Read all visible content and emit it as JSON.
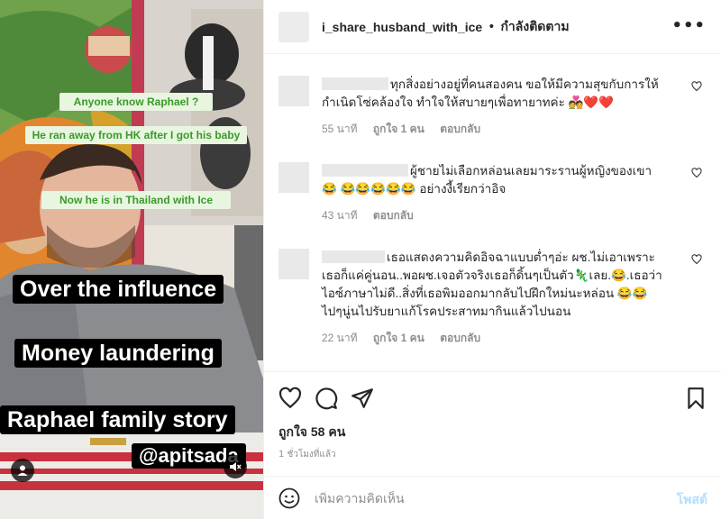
{
  "media": {
    "captions_small": [
      "Anyone know Raphael ?",
      "He ran away from HK after I got his baby",
      "Now he is in Thailand with Ice"
    ],
    "captions_big": [
      "Over the influence",
      "Money laundering",
      "Raphael family story"
    ],
    "mention": "@apitsada",
    "icons": {
      "profile": "person-icon",
      "sound": "muted-speaker-icon"
    }
  },
  "post": {
    "username": "i_share_husband_with_ice",
    "separator": "•",
    "follow_status": "กำลังติดตาม",
    "more_label": "•••"
  },
  "comments": [
    {
      "text": "ทุกสิ่งอย่างอยู่ที่คนสองคน ขอให้มีความสุขกับการให้กำเนิดโซ่คล้องใจ ทำใจให้สบายๆเพื่อทายาทค่ะ 💑❤️❤️",
      "time": "55 นาที",
      "likes": "ถูกใจ 1 คน",
      "reply": "ตอบกลับ"
    },
    {
      "text": "ผู้ชายไม่เลือกหล่อนเลยมาระรานผู้หญิงของเขา 😂 😂😂😂😂😂 อย่างงี้เรียกว่าอิจ",
      "time": "43 นาที",
      "likes": "",
      "reply": "ตอบกลับ"
    },
    {
      "text": "เธอแสดงความคิดอิจฉาแบบต่ำๆอ่ะ ผช.ไม่เอาเพราะเธอก็แค่คู่นอน..พอผช.เจอตัวจริงเธอก็ดิ้นๆเป็นตัว🦎เลย.😂.เธอว่าไอซ์ภาษาไม่ดี..สิ่งที่เธอพิมออกมากลับไปฝึกใหม่นะหล่อน 😂😂 ไปๆนู่นไปรับยาแก้โรคประสาทมากินแล้วไปนอน",
      "time": "22 นาที",
      "likes": "ถูกใจ 1 คน",
      "reply": "ตอบกลับ"
    }
  ],
  "actions": {
    "likes_count": "ถูกใจ 58 คน",
    "timestamp": "1 ชั่วโมงที่แล้ว"
  },
  "composer": {
    "placeholder": "เพิ่มความคิดเห็น",
    "post_label": "โพสต์"
  },
  "colors": {
    "caption_green": "#3a9a2a",
    "caption_bg": "#e8f6e0",
    "post_disabled": "#b2dffc",
    "heart_red": "#ed4956"
  }
}
